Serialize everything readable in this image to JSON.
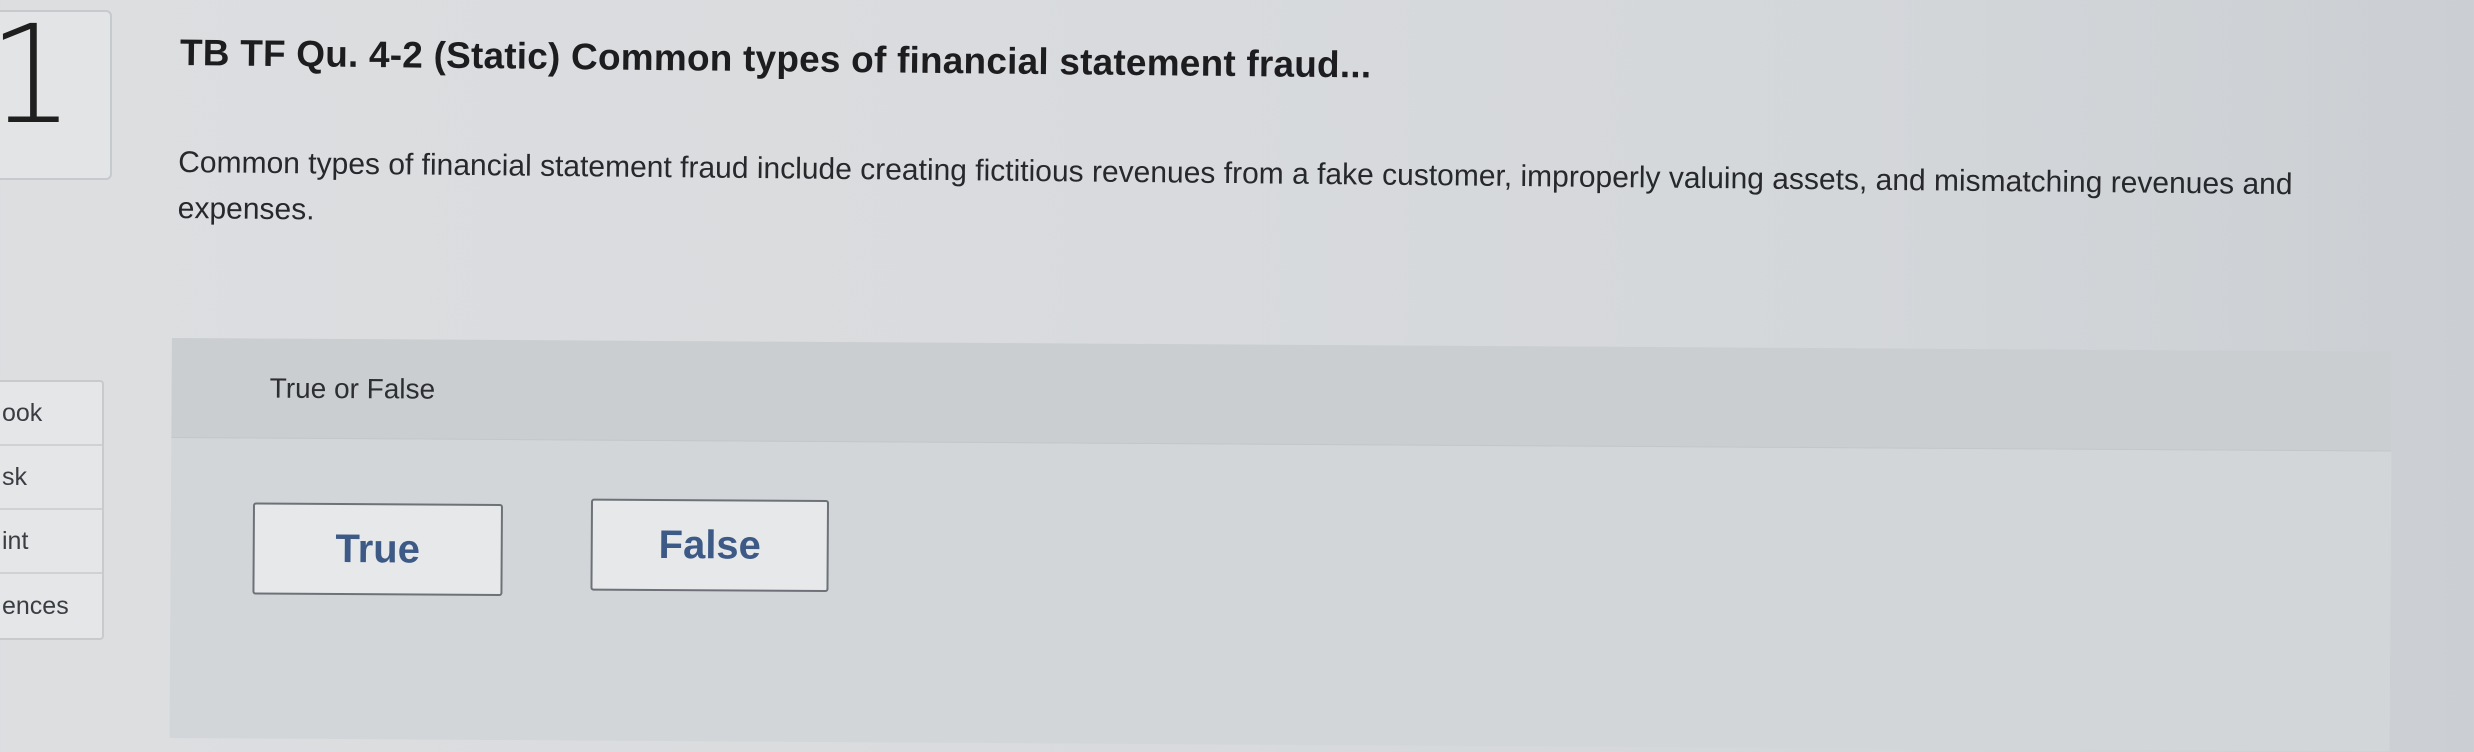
{
  "question": {
    "number": "1",
    "title": "TB TF Qu. 4-2 (Static) Common types of financial statement fraud...",
    "body": "Common types of financial statement fraud include creating fictitious revenues from a fake customer, improperly valuing assets, and mismatching revenues and expenses."
  },
  "sidebar": {
    "items": [
      {
        "label": "ook"
      },
      {
        "label": "sk"
      },
      {
        "label": "int"
      },
      {
        "label": "ences"
      }
    ]
  },
  "answer": {
    "prompt": "True or False",
    "options": [
      {
        "label": "True"
      },
      {
        "label": "False"
      }
    ]
  },
  "colors": {
    "choice_text": "#3d5a86",
    "background": "#d9dbde"
  }
}
